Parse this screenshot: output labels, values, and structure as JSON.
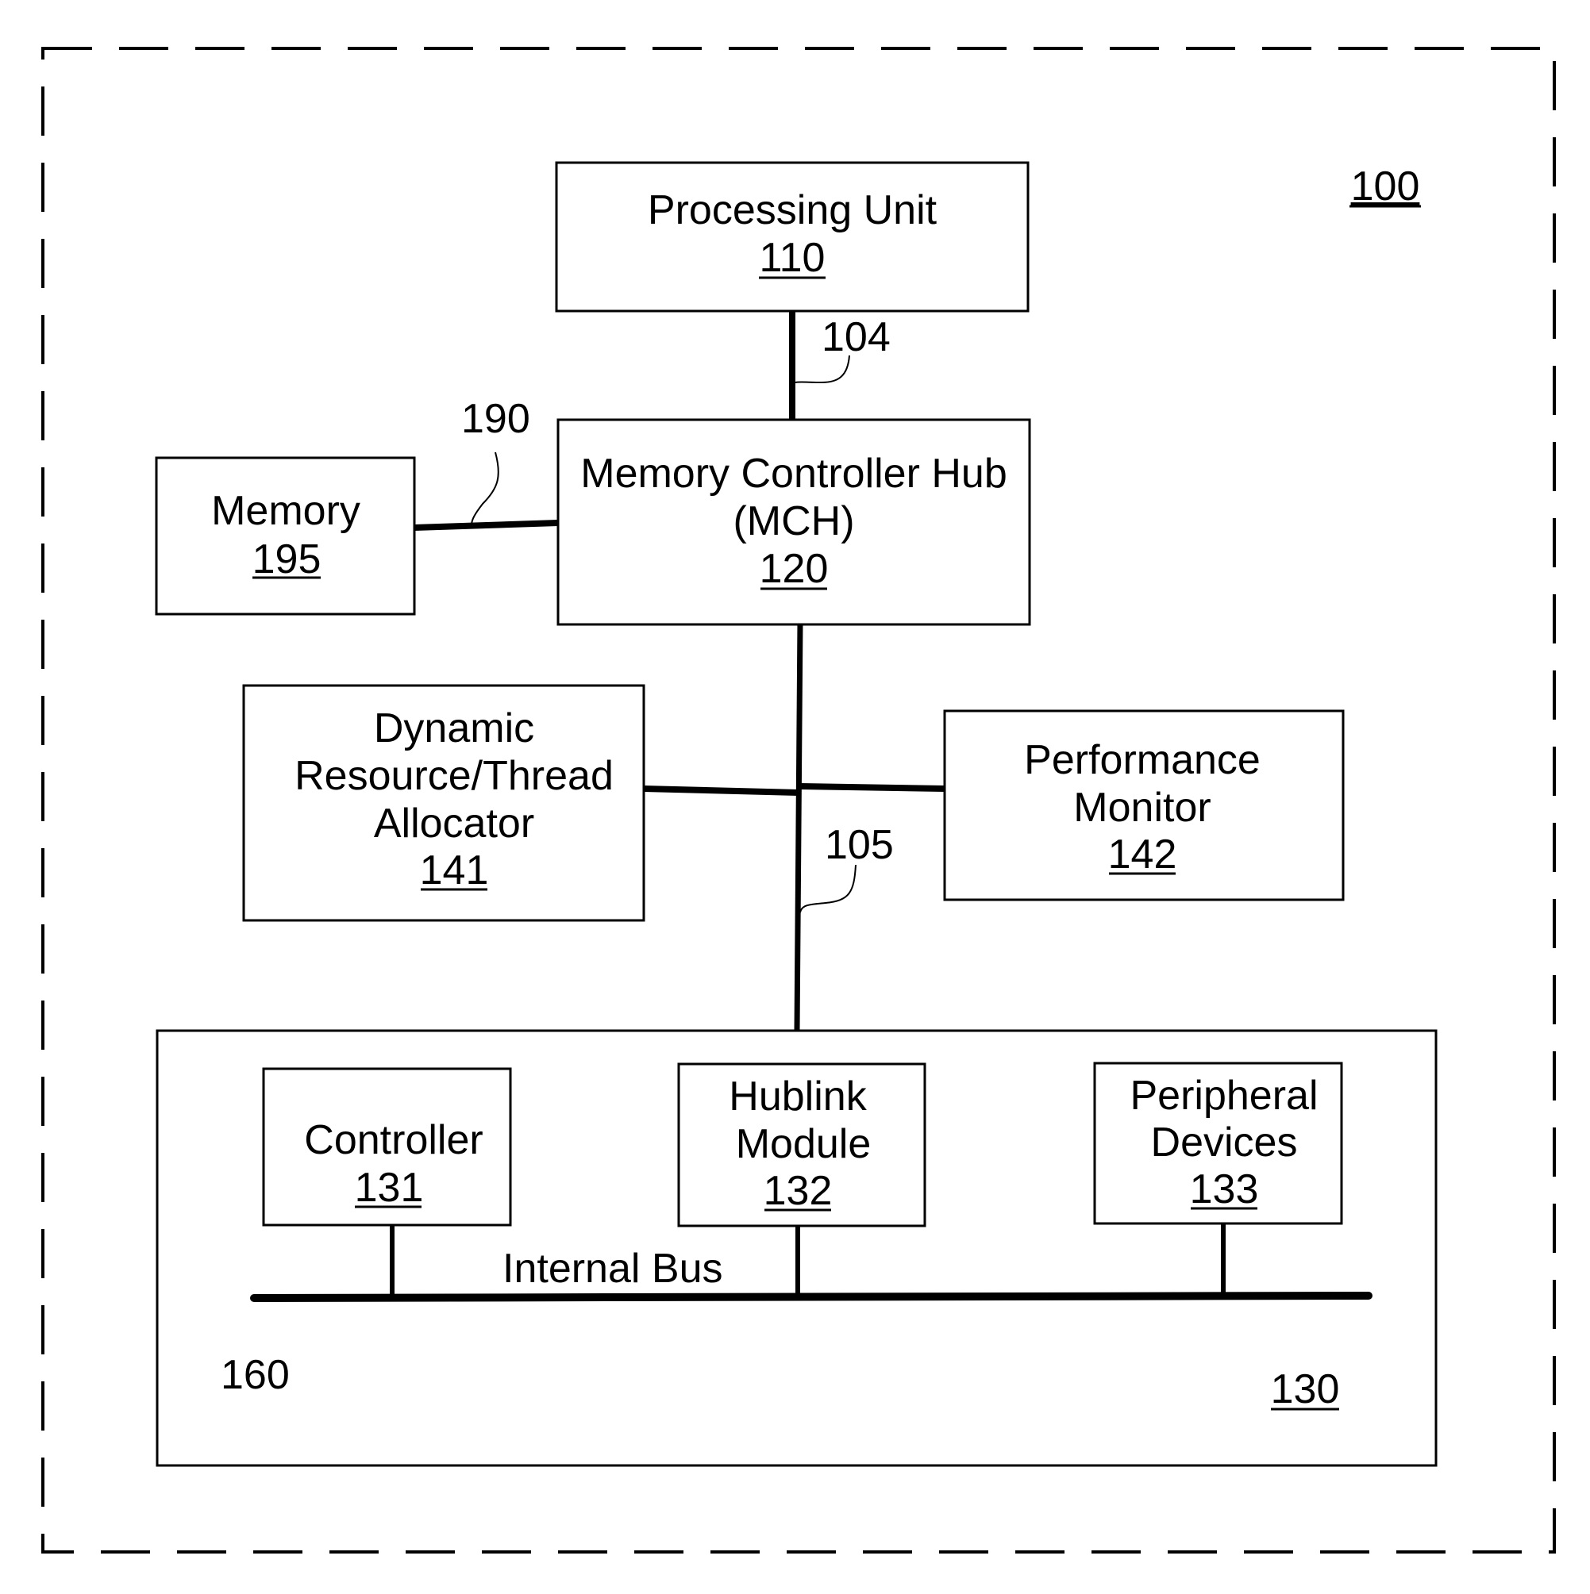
{
  "figure": {
    "ref": "100",
    "blocks": {
      "processing_unit": {
        "label": [
          "Processing Unit"
        ],
        "ref": "110"
      },
      "mch": {
        "label": [
          "Memory Controller Hub",
          "(MCH)"
        ],
        "ref": "120"
      },
      "memory": {
        "label": [
          "Memory"
        ],
        "ref": "195"
      },
      "allocator": {
        "label": [
          "Dynamic",
          "Resource/Thread",
          "Allocator"
        ],
        "ref": "141"
      },
      "perf_monitor": {
        "label": [
          "Performance",
          "Monitor"
        ],
        "ref": "142"
      },
      "io_hub": {
        "ref": "130"
      },
      "controller": {
        "label": [
          "Controller"
        ],
        "ref": "131"
      },
      "hublink": {
        "label": [
          "Hublink",
          "Module"
        ],
        "ref": "132"
      },
      "peripheral": {
        "label": [
          "Peripheral",
          "Devices"
        ],
        "ref": "133"
      }
    },
    "links": {
      "cpu_mch": "104",
      "mch_memory": "190",
      "mch_io": "105",
      "internal_bus": "160",
      "internal_bus_label": "Internal Bus"
    }
  }
}
